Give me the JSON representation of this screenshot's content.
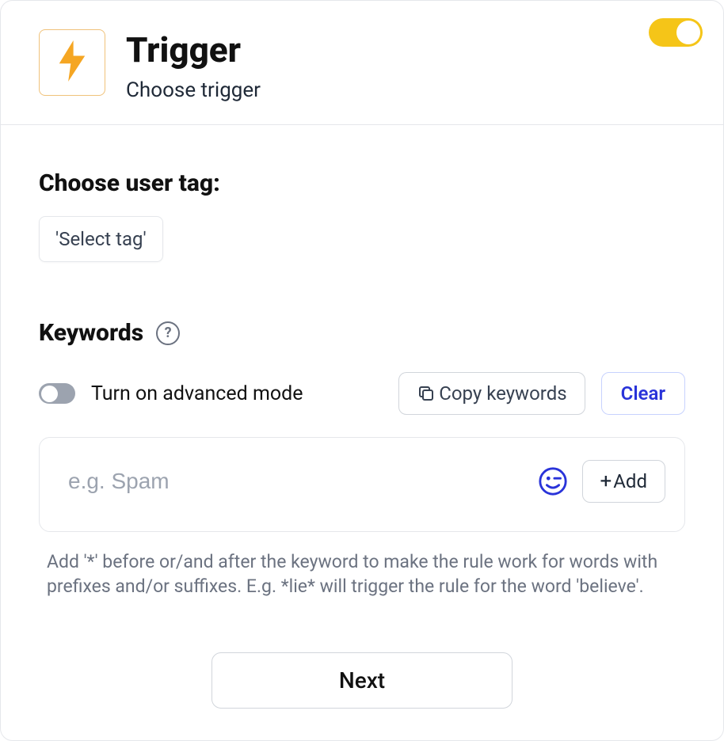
{
  "header": {
    "title": "Trigger",
    "subtitle": "Choose trigger"
  },
  "section": {
    "user_tag_label": "Choose user tag:",
    "select_tag_label": "'Select tag'",
    "keywords_label": "Keywords",
    "help_icon": "?",
    "advanced_label": "Turn on advanced mode",
    "copy_label": "Copy keywords",
    "clear_label": "Clear",
    "input_placeholder": "e.g. Spam",
    "add_label": "Add",
    "help_text": "Add '*' before or/and after the keyword to make the rule work for words with prefixes and/or suffixes. E.g. *lie* will trigger the rule for the word 'believe'."
  },
  "footer": {
    "next_label": "Next"
  },
  "icons": {
    "trigger": "lightning-icon",
    "help": "question-icon",
    "copy": "copy-icon",
    "emoji": "emoji-wink-icon",
    "plus": "plus-icon"
  },
  "toggles": {
    "main_enabled": true,
    "advanced_enabled": false
  }
}
